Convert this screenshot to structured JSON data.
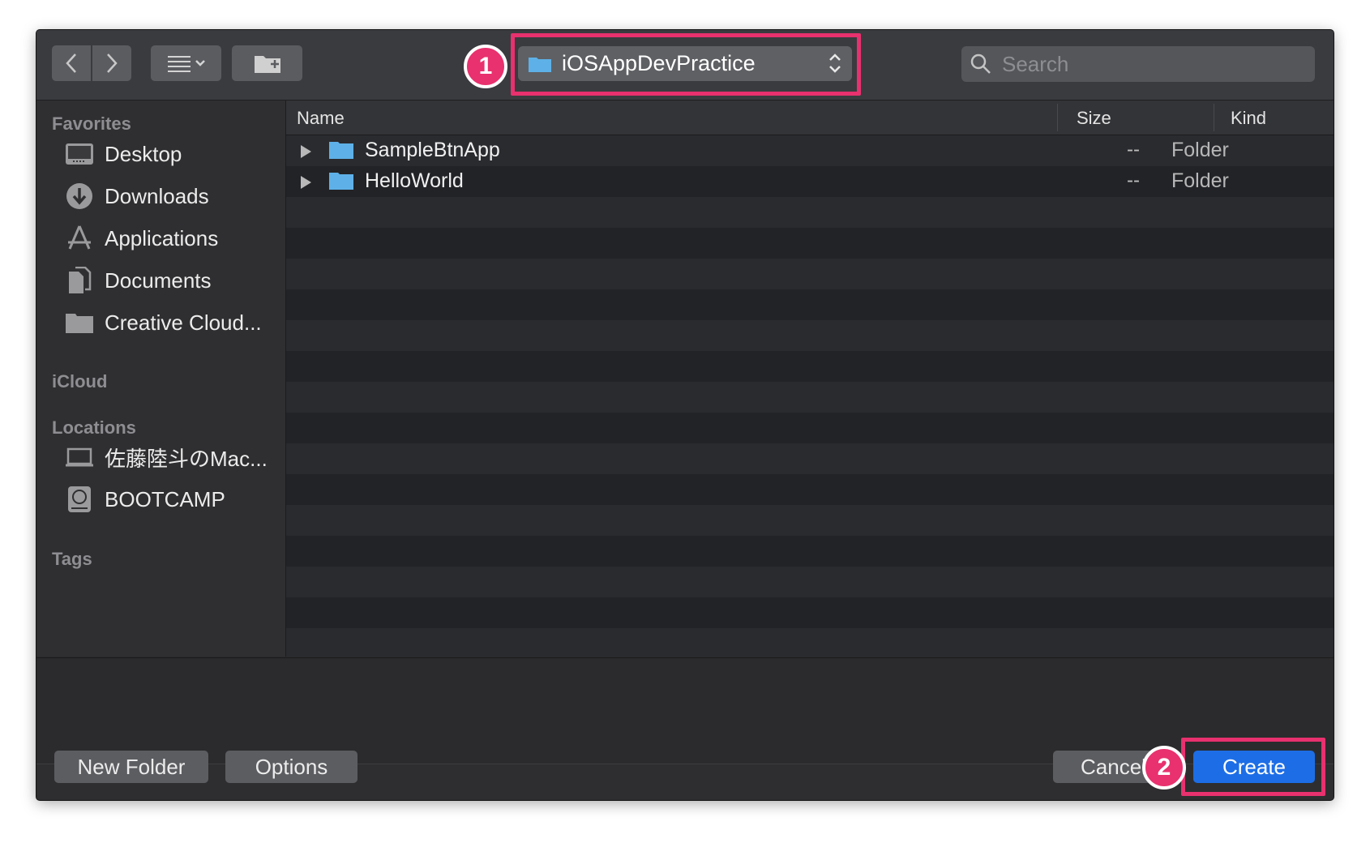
{
  "toolbar": {
    "path_folder": "iOSAppDevPractice",
    "search_placeholder": "Search",
    "annotation_1": "1"
  },
  "sidebar": {
    "favorites_header": "Favorites",
    "favorites": [
      {
        "label": "Desktop",
        "icon": "desktop-icon"
      },
      {
        "label": "Downloads",
        "icon": "downloads-icon"
      },
      {
        "label": "Applications",
        "icon": "applications-icon"
      },
      {
        "label": "Documents",
        "icon": "documents-icon"
      },
      {
        "label": "Creative Cloud...",
        "icon": "folder-icon"
      }
    ],
    "icloud_header": "iCloud",
    "locations_header": "Locations",
    "locations": [
      {
        "label": "佐藤陸斗のMac...",
        "icon": "laptop-icon"
      },
      {
        "label": "BOOTCAMP",
        "icon": "disk-icon"
      }
    ],
    "tags_header": "Tags"
  },
  "columns": {
    "name": "Name",
    "size": "Size",
    "kind": "Kind"
  },
  "files": [
    {
      "name": "SampleBtnApp",
      "size": "--",
      "kind": "Folder"
    },
    {
      "name": "HelloWorld",
      "size": "--",
      "kind": "Folder"
    }
  ],
  "buttons": {
    "new_folder": "New Folder",
    "options": "Options",
    "cancel": "Cancel",
    "create": "Create",
    "annotation_2": "2"
  },
  "colors": {
    "annotation": "#e8316e",
    "primary_button": "#1d6ee6",
    "folder_blue": "#5eb1e8"
  }
}
